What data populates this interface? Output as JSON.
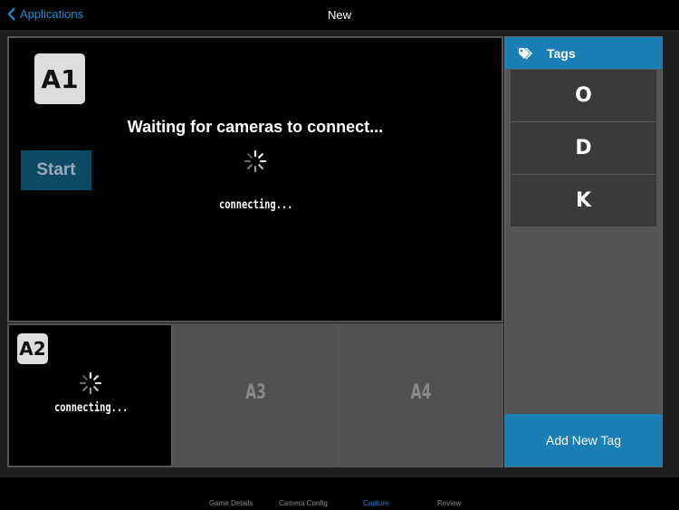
{
  "nav": {
    "back_label": "Applications",
    "title": "New"
  },
  "main_camera": {
    "label": "A1",
    "status": "Waiting for cameras to connect...",
    "start_label": "Start",
    "connecting": "connecting..."
  },
  "cameras": [
    {
      "label": "A2",
      "connecting": "connecting..."
    },
    {
      "label": "A3"
    },
    {
      "label": "A4"
    }
  ],
  "tags": {
    "title": "Tags",
    "items": [
      "O",
      "D",
      "K"
    ],
    "add_label": "Add New Tag"
  },
  "tabs": [
    "Game Details",
    "Camera Config",
    "Capture",
    "Review"
  ],
  "colors": {
    "accent": "#1a7fb5",
    "link": "#1a8fd6"
  }
}
